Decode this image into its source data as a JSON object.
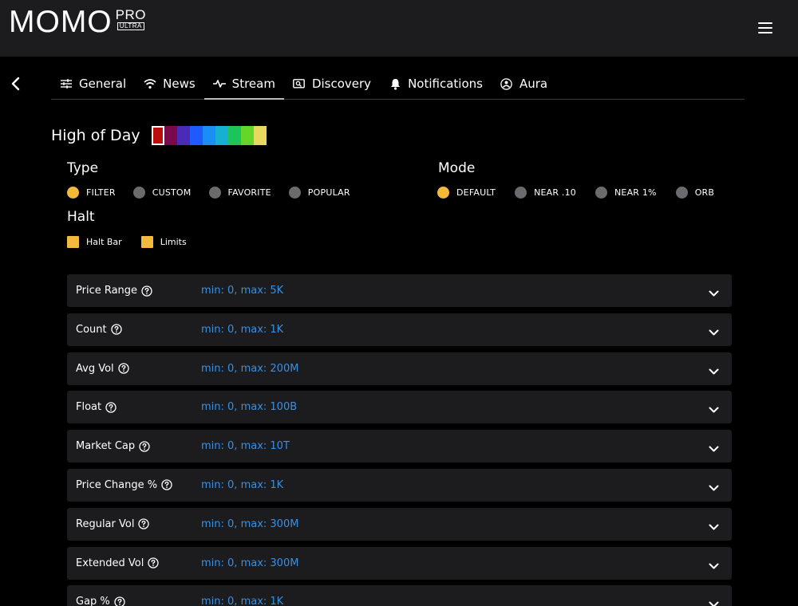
{
  "header": {
    "logo_main": "MOMO",
    "logo_pro": "PRO",
    "logo_ultra": "ULTRA"
  },
  "tabs": [
    {
      "label": "General",
      "icon": "sliders-icon"
    },
    {
      "label": "News",
      "icon": "wifi-icon"
    },
    {
      "label": "Stream",
      "icon": "pulse-icon",
      "active": true
    },
    {
      "label": "Discovery",
      "icon": "search-screen-icon"
    },
    {
      "label": "Notifications",
      "icon": "bell-icon"
    },
    {
      "label": "Aura",
      "icon": "person-icon"
    }
  ],
  "high_of_day": {
    "title": "High of Day",
    "colors": [
      "#b90f0f",
      "#7a0a4c",
      "#4a2bb8",
      "#1e5bff",
      "#1a8ef5",
      "#18b0d0",
      "#1ec45a",
      "#64d62a",
      "#e8d860"
    ],
    "selected_index": 0
  },
  "type": {
    "title": "Type",
    "options": [
      "FILTER",
      "CUSTOM",
      "FAVORITE",
      "POPULAR"
    ],
    "selected": "FILTER"
  },
  "mode": {
    "title": "Mode",
    "options": [
      "DEFAULT",
      "NEAR .10",
      "NEAR 1%",
      "ORB"
    ],
    "selected": "DEFAULT"
  },
  "halt": {
    "title": "Halt",
    "options": [
      "Halt Bar",
      "Limits"
    ]
  },
  "colors": {
    "accent": "#f2b93c",
    "radio_off": "#6b6b6f",
    "value_blue": "#3b8fe0",
    "row_bg": "#1c1c1f"
  },
  "filters": [
    {
      "label": "Price Range",
      "value": "min: 0, max: 5K"
    },
    {
      "label": "Count",
      "value": "min: 0, max: 1K"
    },
    {
      "label": "Avg Vol",
      "value": "min: 0, max: 200M"
    },
    {
      "label": "Float",
      "value": "min: 0, max: 100B"
    },
    {
      "label": "Market Cap",
      "value": "min: 0, max: 10T"
    },
    {
      "label": "Price Change %",
      "value": "min: 0, max: 1K"
    },
    {
      "label": "Regular Vol",
      "value": "min: 0, max: 300M"
    },
    {
      "label": "Extended Vol",
      "value": "min: 0, max: 300M"
    },
    {
      "label": "Gap %",
      "value": "min: 0, max: 1K"
    }
  ]
}
